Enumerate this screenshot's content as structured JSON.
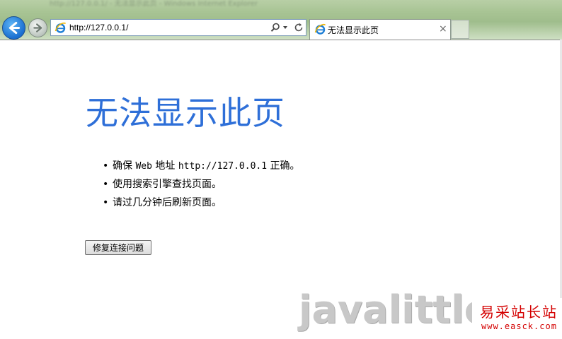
{
  "window": {
    "blurred_title": "http://127.0.0.1/ - 无法显示此页 - Windows Internet Explorer"
  },
  "address_bar": {
    "url": "http://127.0.0.1/"
  },
  "tab": {
    "title": "无法显示此页",
    "close_glyph": "×"
  },
  "page": {
    "heading": "无法显示此页",
    "tips": [
      {
        "text_before": "确保 ",
        "mono1": "Web",
        "text_mid": " 地址 ",
        "mono2": "http://127.0.0.1",
        "text_after": " 正确。"
      },
      {
        "text": "使用搜索引擎查找页面。"
      },
      {
        "text": "请过几分钟后刷新页面。"
      }
    ],
    "bullet": "•",
    "fix_button": "修复连接问题"
  },
  "watermark": {
    "brand": "javalittle",
    "cn_site": "易采站长站",
    "site_url": "www.easck.com"
  },
  "colors": {
    "heading": "#2e6fd8",
    "watermark_red": "#d40000",
    "chrome_green": "#a8c494"
  }
}
